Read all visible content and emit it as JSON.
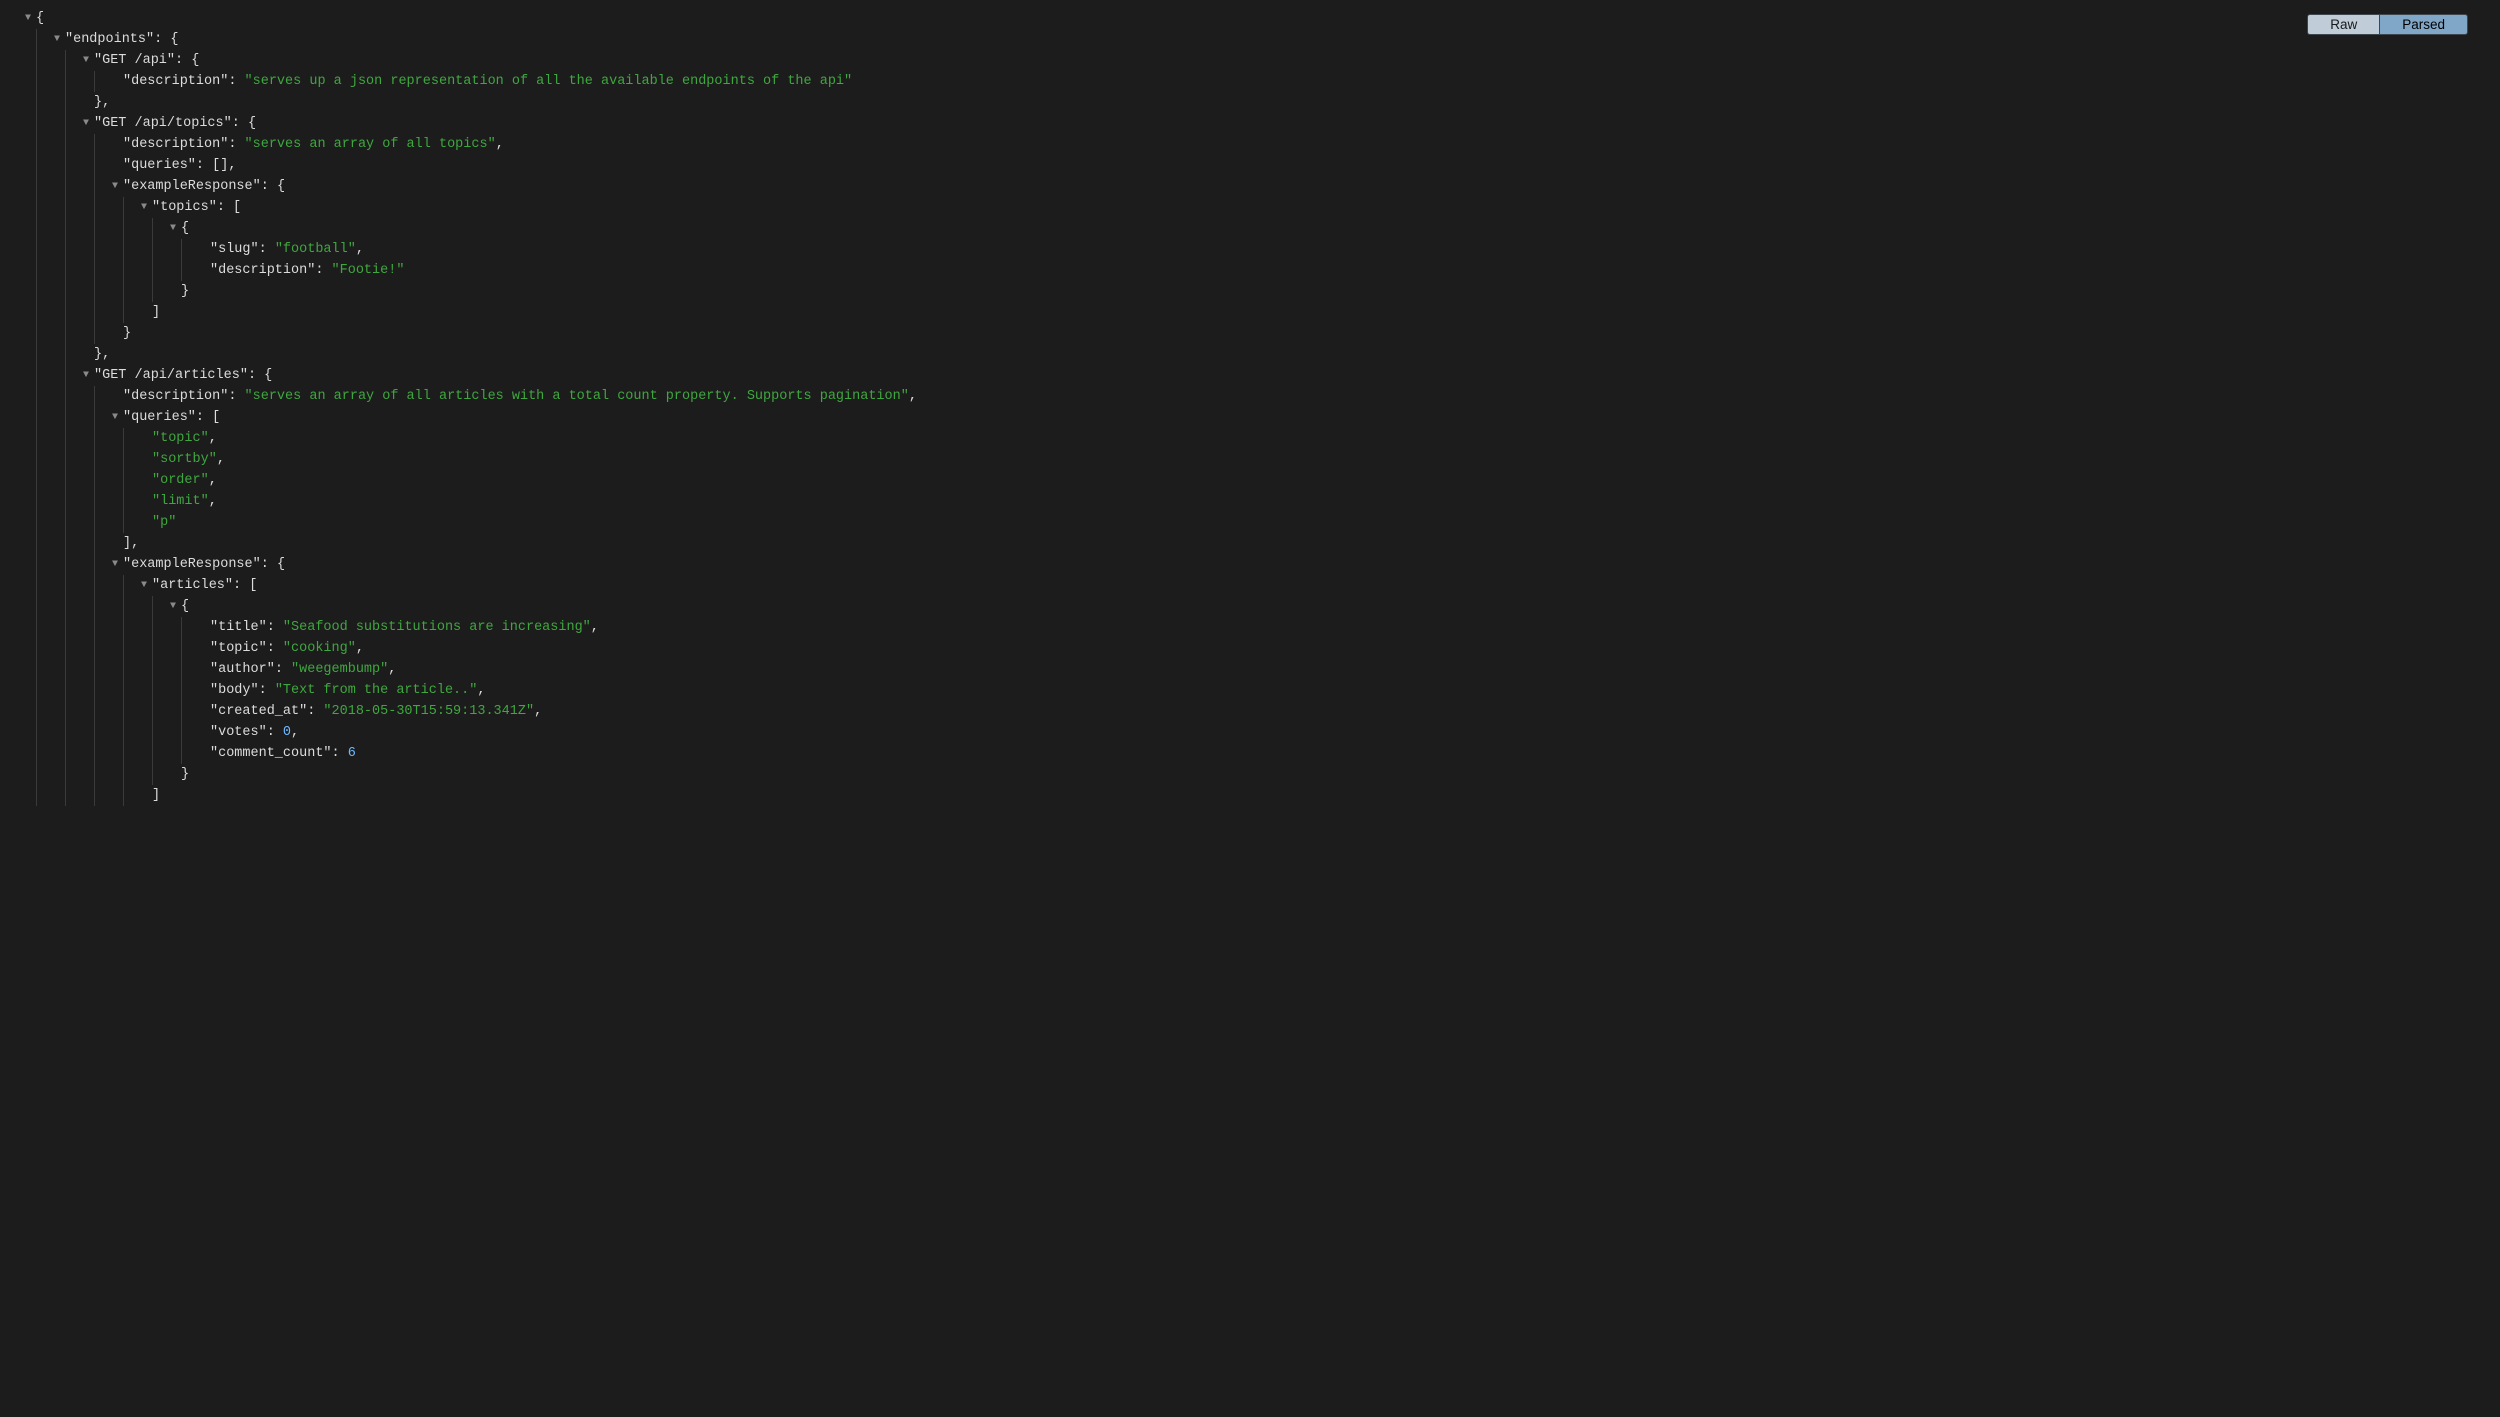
{
  "toolbar": {
    "raw": "Raw",
    "parsed": "Parsed"
  },
  "json": {
    "endpoints_key": "\"endpoints\"",
    "ep1_key": "\"GET /api\"",
    "ep1_desc_key": "\"description\"",
    "ep1_desc_val": "\"serves up a json representation of all the available endpoints of the api\"",
    "ep2_key": "\"GET /api/topics\"",
    "ep2_desc_key": "\"description\"",
    "ep2_desc_val": "\"serves an array of all topics\"",
    "ep2_queries_key": "\"queries\"",
    "ep2_queries_val": "[]",
    "ep2_ex_key": "\"exampleResponse\"",
    "ep2_topics_key": "\"topics\"",
    "ep2_slug_key": "\"slug\"",
    "ep2_slug_val": "\"football\"",
    "ep2_tdesc_key": "\"description\"",
    "ep2_tdesc_val": "\"Footie!\"",
    "ep3_key": "\"GET /api/articles\"",
    "ep3_desc_key": "\"description\"",
    "ep3_desc_val": "\"serves an array of all articles with a total count property. Supports pagination\"",
    "ep3_queries_key": "\"queries\"",
    "ep3_q0": "\"topic\"",
    "ep3_q1": "\"sortby\"",
    "ep3_q2": "\"order\"",
    "ep3_q3": "\"limit\"",
    "ep3_q4": "\"p\"",
    "ep3_ex_key": "\"exampleResponse\"",
    "ep3_articles_key": "\"articles\"",
    "ep3_title_key": "\"title\"",
    "ep3_title_val": "\"Seafood substitutions are increasing\"",
    "ep3_topic_key": "\"topic\"",
    "ep3_topic_val": "\"cooking\"",
    "ep3_author_key": "\"author\"",
    "ep3_author_val": "\"weegembump\"",
    "ep3_body_key": "\"body\"",
    "ep3_body_val": "\"Text from the article..\"",
    "ep3_created_key": "\"created_at\"",
    "ep3_created_val": "\"2018-05-30T15:59:13.341Z\"",
    "ep3_votes_key": "\"votes\"",
    "ep3_votes_val": "0",
    "ep3_cc_key": "\"comment_count\"",
    "ep3_cc_val": "6"
  }
}
